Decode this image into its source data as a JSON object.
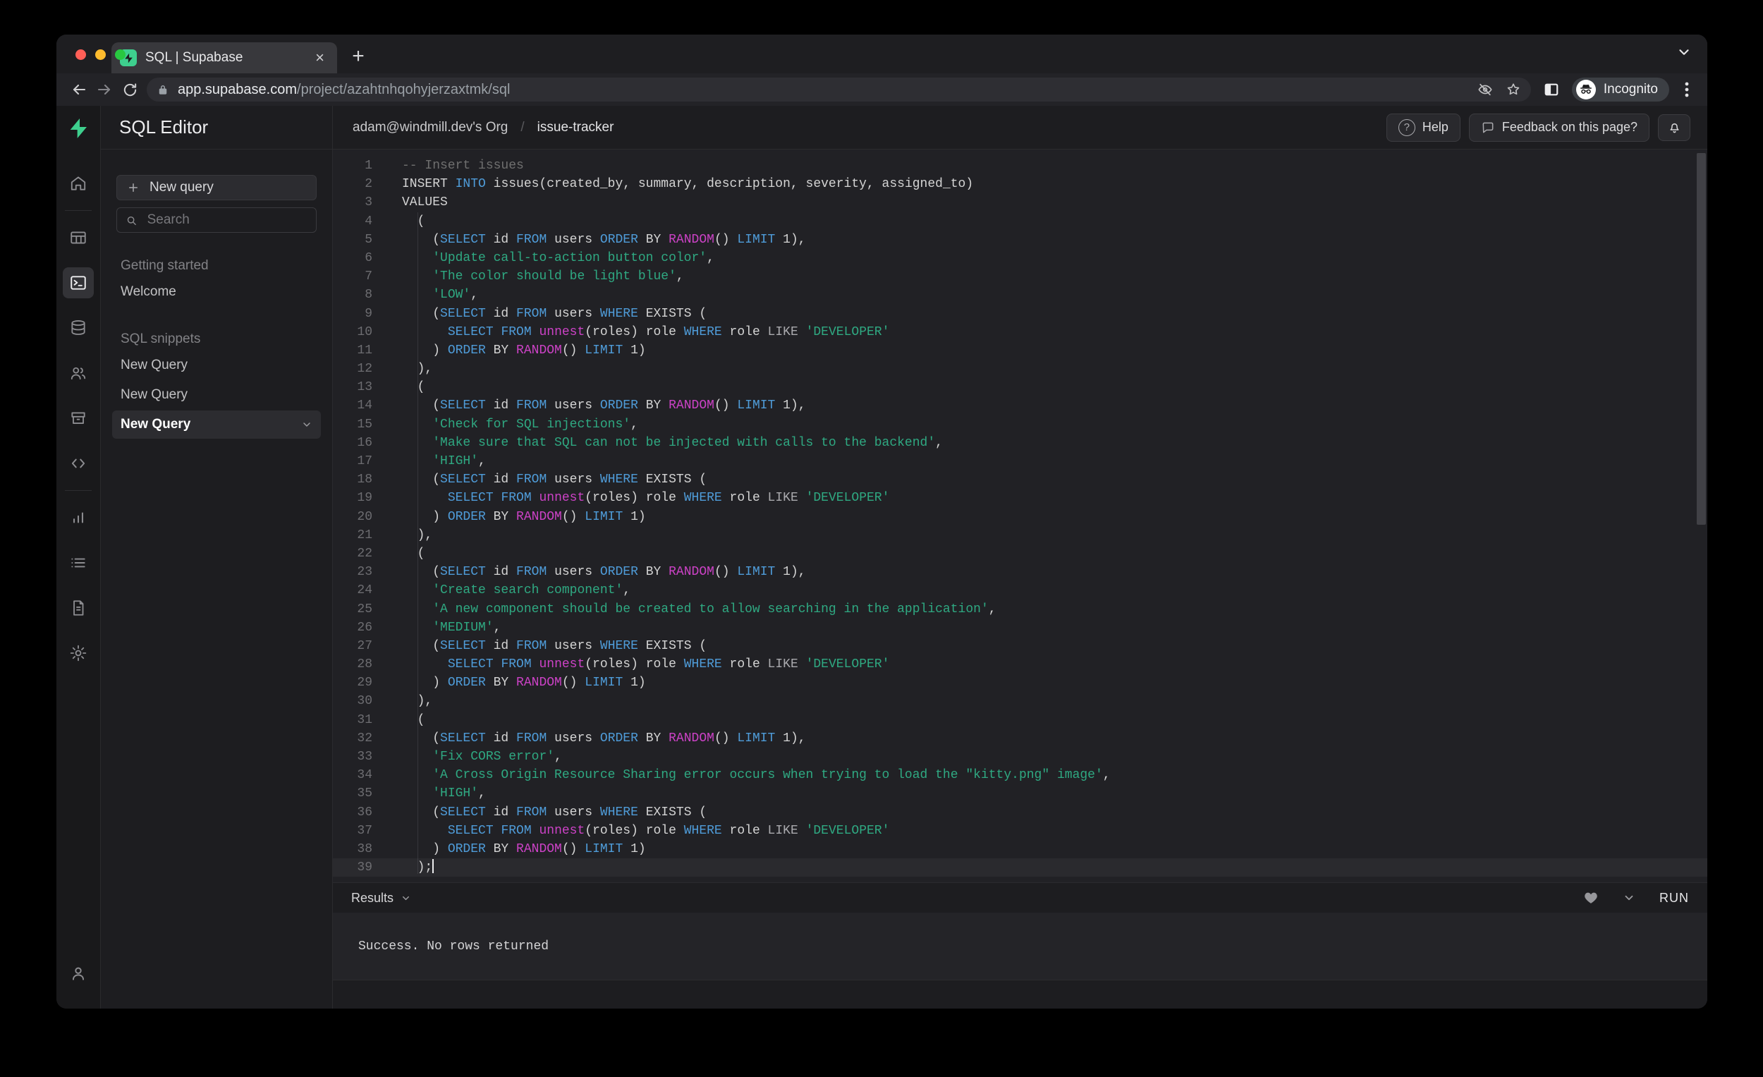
{
  "colors": {
    "keyword": "#4f9cd9",
    "function": "#cc42c6",
    "string": "#2fa982",
    "comment": "#6f6f6f",
    "default": "#d4d4d4",
    "operator": "#aaaaae",
    "accent_green": "#3ecf8e"
  },
  "browser": {
    "tab_title": "SQL | Supabase",
    "url_host": "app.supabase.com",
    "url_path": "/project/azahtnhqohyjerzaxtmk/sql",
    "incognito_label": "Incognito",
    "icons": [
      "supabase-favicon",
      "close-icon",
      "new-tab-icon",
      "chevron-down-icon",
      "back-icon",
      "forward-icon",
      "reload-icon",
      "lock-icon",
      "eye-slash-icon",
      "star-icon",
      "side-panel-icon",
      "incognito-icon",
      "kebab-menu-icon",
      "traffic-close",
      "traffic-minimize",
      "traffic-zoom"
    ]
  },
  "rail": {
    "icons": [
      "supabase-logo",
      "home-icon",
      "table-editor-icon",
      "sql-editor-icon",
      "database-icon",
      "auth-icon",
      "storage-icon",
      "api-icon",
      "reports-icon",
      "logs-icon",
      "docs-icon",
      "settings-icon",
      "account-icon"
    ],
    "active": "sql-editor-icon"
  },
  "panel": {
    "title": "SQL Editor",
    "new_query_label": "New query",
    "search_placeholder": "Search",
    "sections": [
      {
        "label": "Getting started",
        "items": [
          {
            "label": "Welcome",
            "active": false
          }
        ]
      },
      {
        "label": "SQL snippets",
        "items": [
          {
            "label": "New Query",
            "active": false
          },
          {
            "label": "New Query",
            "active": false
          },
          {
            "label": "New Query",
            "active": true
          }
        ]
      }
    ]
  },
  "header": {
    "breadcrumb_org": "adam@windmill.dev's Org",
    "breadcrumb_sep": "/",
    "breadcrumb_project": "issue-tracker",
    "help_label": "Help",
    "feedback_label": "Feedback on this page?",
    "icons": [
      "help-icon",
      "chat-bubble-icon",
      "bell-icon"
    ]
  },
  "editor": {
    "cursor_line": 39,
    "lines": [
      [
        [
          "c",
          "-- Insert issues"
        ]
      ],
      [
        [
          "d",
          "INSERT "
        ],
        [
          "k",
          "INTO"
        ],
        [
          "d",
          " issues(created_by, summary, description, severity, assigned_to)"
        ]
      ],
      [
        [
          "d",
          "VALUES"
        ]
      ],
      [
        [
          "d",
          "  ("
        ]
      ],
      [
        [
          "d",
          "    ("
        ],
        [
          "k",
          "SELECT"
        ],
        [
          "d",
          " id "
        ],
        [
          "k",
          "FROM"
        ],
        [
          "d",
          " users "
        ],
        [
          "k",
          "ORDER"
        ],
        [
          "d",
          " BY "
        ],
        [
          "f",
          "RANDOM"
        ],
        [
          "d",
          "() "
        ],
        [
          "k",
          "LIMIT"
        ],
        [
          "d",
          " 1),"
        ]
      ],
      [
        [
          "d",
          "    "
        ],
        [
          "s",
          "'Update call-to-action button color'"
        ],
        [
          "d",
          ","
        ]
      ],
      [
        [
          "d",
          "    "
        ],
        [
          "s",
          "'The color should be light blue'"
        ],
        [
          "d",
          ","
        ]
      ],
      [
        [
          "d",
          "    "
        ],
        [
          "s",
          "'LOW'"
        ],
        [
          "d",
          ","
        ]
      ],
      [
        [
          "d",
          "    ("
        ],
        [
          "k",
          "SELECT"
        ],
        [
          "d",
          " id "
        ],
        [
          "k",
          "FROM"
        ],
        [
          "d",
          " users "
        ],
        [
          "k",
          "WHERE"
        ],
        [
          "d",
          " EXISTS ("
        ]
      ],
      [
        [
          "d",
          "      "
        ],
        [
          "k",
          "SELECT"
        ],
        [
          "d",
          " "
        ],
        [
          "k",
          "FROM"
        ],
        [
          "d",
          " "
        ],
        [
          "f",
          "unnest"
        ],
        [
          "d",
          "(roles) role "
        ],
        [
          "k",
          "WHERE"
        ],
        [
          "d",
          " role "
        ],
        [
          "o",
          "LIKE"
        ],
        [
          "d",
          " "
        ],
        [
          "s",
          "'DEVELOPER'"
        ]
      ],
      [
        [
          "d",
          "    ) "
        ],
        [
          "k",
          "ORDER"
        ],
        [
          "d",
          " BY "
        ],
        [
          "f",
          "RANDOM"
        ],
        [
          "d",
          "() "
        ],
        [
          "k",
          "LIMIT"
        ],
        [
          "d",
          " 1)"
        ]
      ],
      [
        [
          "d",
          "  ),"
        ]
      ],
      [
        [
          "d",
          "  ("
        ]
      ],
      [
        [
          "d",
          "    ("
        ],
        [
          "k",
          "SELECT"
        ],
        [
          "d",
          " id "
        ],
        [
          "k",
          "FROM"
        ],
        [
          "d",
          " users "
        ],
        [
          "k",
          "ORDER"
        ],
        [
          "d",
          " BY "
        ],
        [
          "f",
          "RANDOM"
        ],
        [
          "d",
          "() "
        ],
        [
          "k",
          "LIMIT"
        ],
        [
          "d",
          " 1),"
        ]
      ],
      [
        [
          "d",
          "    "
        ],
        [
          "s",
          "'Check for SQL injections'"
        ],
        [
          "d",
          ","
        ]
      ],
      [
        [
          "d",
          "    "
        ],
        [
          "s",
          "'Make sure that SQL can not be injected with calls to the backend'"
        ],
        [
          "d",
          ","
        ]
      ],
      [
        [
          "d",
          "    "
        ],
        [
          "s",
          "'HIGH'"
        ],
        [
          "d",
          ","
        ]
      ],
      [
        [
          "d",
          "    ("
        ],
        [
          "k",
          "SELECT"
        ],
        [
          "d",
          " id "
        ],
        [
          "k",
          "FROM"
        ],
        [
          "d",
          " users "
        ],
        [
          "k",
          "WHERE"
        ],
        [
          "d",
          " EXISTS ("
        ]
      ],
      [
        [
          "d",
          "      "
        ],
        [
          "k",
          "SELECT"
        ],
        [
          "d",
          " "
        ],
        [
          "k",
          "FROM"
        ],
        [
          "d",
          " "
        ],
        [
          "f",
          "unnest"
        ],
        [
          "d",
          "(roles) role "
        ],
        [
          "k",
          "WHERE"
        ],
        [
          "d",
          " role "
        ],
        [
          "o",
          "LIKE"
        ],
        [
          "d",
          " "
        ],
        [
          "s",
          "'DEVELOPER'"
        ]
      ],
      [
        [
          "d",
          "    ) "
        ],
        [
          "k",
          "ORDER"
        ],
        [
          "d",
          " BY "
        ],
        [
          "f",
          "RANDOM"
        ],
        [
          "d",
          "() "
        ],
        [
          "k",
          "LIMIT"
        ],
        [
          "d",
          " 1)"
        ]
      ],
      [
        [
          "d",
          "  ),"
        ]
      ],
      [
        [
          "d",
          "  ("
        ]
      ],
      [
        [
          "d",
          "    ("
        ],
        [
          "k",
          "SELECT"
        ],
        [
          "d",
          " id "
        ],
        [
          "k",
          "FROM"
        ],
        [
          "d",
          " users "
        ],
        [
          "k",
          "ORDER"
        ],
        [
          "d",
          " BY "
        ],
        [
          "f",
          "RANDOM"
        ],
        [
          "d",
          "() "
        ],
        [
          "k",
          "LIMIT"
        ],
        [
          "d",
          " 1),"
        ]
      ],
      [
        [
          "d",
          "    "
        ],
        [
          "s",
          "'Create search component'"
        ],
        [
          "d",
          ","
        ]
      ],
      [
        [
          "d",
          "    "
        ],
        [
          "s",
          "'A new component should be created to allow searching in the application'"
        ],
        [
          "d",
          ","
        ]
      ],
      [
        [
          "d",
          "    "
        ],
        [
          "s",
          "'MEDIUM'"
        ],
        [
          "d",
          ","
        ]
      ],
      [
        [
          "d",
          "    ("
        ],
        [
          "k",
          "SELECT"
        ],
        [
          "d",
          " id "
        ],
        [
          "k",
          "FROM"
        ],
        [
          "d",
          " users "
        ],
        [
          "k",
          "WHERE"
        ],
        [
          "d",
          " EXISTS ("
        ]
      ],
      [
        [
          "d",
          "      "
        ],
        [
          "k",
          "SELECT"
        ],
        [
          "d",
          " "
        ],
        [
          "k",
          "FROM"
        ],
        [
          "d",
          " "
        ],
        [
          "f",
          "unnest"
        ],
        [
          "d",
          "(roles) role "
        ],
        [
          "k",
          "WHERE"
        ],
        [
          "d",
          " role "
        ],
        [
          "o",
          "LIKE"
        ],
        [
          "d",
          " "
        ],
        [
          "s",
          "'DEVELOPER'"
        ]
      ],
      [
        [
          "d",
          "    ) "
        ],
        [
          "k",
          "ORDER"
        ],
        [
          "d",
          " BY "
        ],
        [
          "f",
          "RANDOM"
        ],
        [
          "d",
          "() "
        ],
        [
          "k",
          "LIMIT"
        ],
        [
          "d",
          " 1)"
        ]
      ],
      [
        [
          "d",
          "  ),"
        ]
      ],
      [
        [
          "d",
          "  ("
        ]
      ],
      [
        [
          "d",
          "    ("
        ],
        [
          "k",
          "SELECT"
        ],
        [
          "d",
          " id "
        ],
        [
          "k",
          "FROM"
        ],
        [
          "d",
          " users "
        ],
        [
          "k",
          "ORDER"
        ],
        [
          "d",
          " BY "
        ],
        [
          "f",
          "RANDOM"
        ],
        [
          "d",
          "() "
        ],
        [
          "k",
          "LIMIT"
        ],
        [
          "d",
          " 1),"
        ]
      ],
      [
        [
          "d",
          "    "
        ],
        [
          "s",
          "'Fix CORS error'"
        ],
        [
          "d",
          ","
        ]
      ],
      [
        [
          "d",
          "    "
        ],
        [
          "s",
          "'A Cross Origin Resource Sharing error occurs when trying to load the \"kitty.png\" image'"
        ],
        [
          "d",
          ","
        ]
      ],
      [
        [
          "d",
          "    "
        ],
        [
          "s",
          "'HIGH'"
        ],
        [
          "d",
          ","
        ]
      ],
      [
        [
          "d",
          "    ("
        ],
        [
          "k",
          "SELECT"
        ],
        [
          "d",
          " id "
        ],
        [
          "k",
          "FROM"
        ],
        [
          "d",
          " users "
        ],
        [
          "k",
          "WHERE"
        ],
        [
          "d",
          " EXISTS ("
        ]
      ],
      [
        [
          "d",
          "      "
        ],
        [
          "k",
          "SELECT"
        ],
        [
          "d",
          " "
        ],
        [
          "k",
          "FROM"
        ],
        [
          "d",
          " "
        ],
        [
          "f",
          "unnest"
        ],
        [
          "d",
          "(roles) role "
        ],
        [
          "k",
          "WHERE"
        ],
        [
          "d",
          " role "
        ],
        [
          "o",
          "LIKE"
        ],
        [
          "d",
          " "
        ],
        [
          "s",
          "'DEVELOPER'"
        ]
      ],
      [
        [
          "d",
          "    ) "
        ],
        [
          "k",
          "ORDER"
        ],
        [
          "d",
          " BY "
        ],
        [
          "f",
          "RANDOM"
        ],
        [
          "d",
          "() "
        ],
        [
          "k",
          "LIMIT"
        ],
        [
          "d",
          " 1)"
        ]
      ],
      [
        [
          "d",
          "  );"
        ]
      ]
    ]
  },
  "results": {
    "label": "Results",
    "run_label": "RUN",
    "message": "Success. No rows returned",
    "icons": [
      "heart-icon",
      "chevron-down-icon"
    ]
  }
}
